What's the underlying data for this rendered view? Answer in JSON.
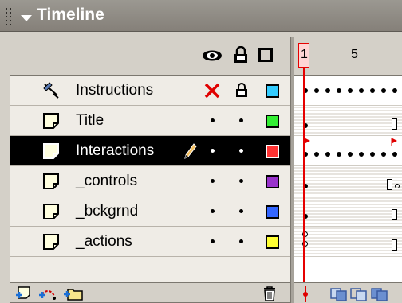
{
  "panel": {
    "title": "Timeline"
  },
  "ruler": {
    "current_frame": "1",
    "frame_label": "5"
  },
  "layers": [
    {
      "name": "Instructions",
      "type": "guide",
      "color": "#33ccff",
      "visible": "hidden",
      "locked": true,
      "selected": false
    },
    {
      "name": "Title",
      "type": "normal",
      "color": "#33ee33",
      "visible": "dot",
      "locked": false,
      "selected": false
    },
    {
      "name": "Interactions",
      "type": "normal",
      "color": "#ff3333",
      "visible": "dot",
      "locked": false,
      "selected": true,
      "editing": true
    },
    {
      "name": "_controls",
      "type": "normal",
      "color": "#9933cc",
      "visible": "dot",
      "locked": false,
      "selected": false
    },
    {
      "name": "_bckgrnd",
      "type": "normal",
      "color": "#3366ff",
      "visible": "dot",
      "locked": false,
      "selected": false
    },
    {
      "name": "_actions",
      "type": "normal",
      "color": "#ffff33",
      "visible": "dot",
      "locked": false,
      "selected": false
    }
  ]
}
